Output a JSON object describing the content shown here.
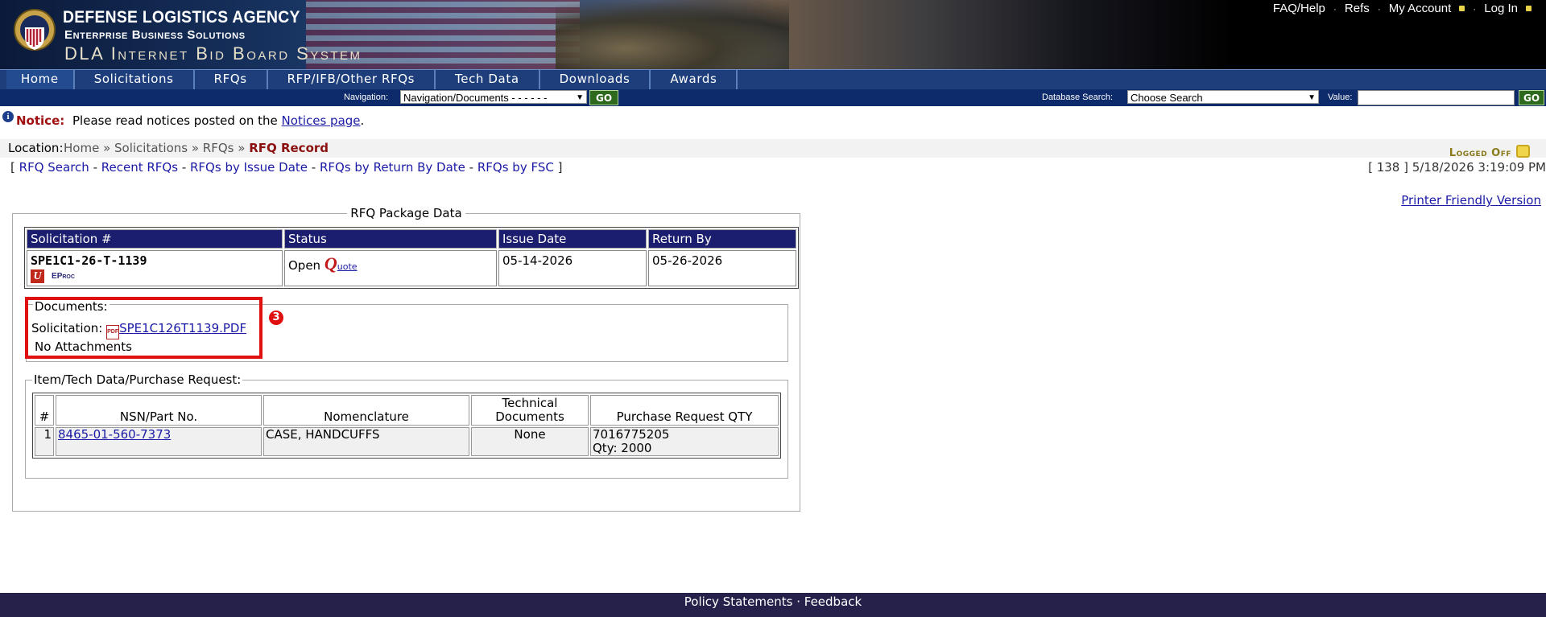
{
  "header": {
    "agency": "DEFENSE LOGISTICS AGENCY",
    "subagency": "Enterprise Business Solutions",
    "system_title": "DLA Internet Bid Board System",
    "toplinks": {
      "faq": "FAQ/Help",
      "refs": "Refs",
      "my_account": "My Account",
      "login": "Log In"
    }
  },
  "menu": [
    "Home",
    "Solicitations",
    "RFQs",
    "RFP/IFB/Other RFQs",
    "Tech Data",
    "Downloads",
    "Awards"
  ],
  "navbar": {
    "nav_label": "Navigation:",
    "nav_value": "Navigation/Documents - - - - - -",
    "go": "GO",
    "db_label": "Database Search:",
    "db_value": "Choose Search",
    "value_label": "Value:"
  },
  "notice": {
    "label": "Notice:",
    "text_before": "Please read notices posted on the ",
    "link": "Notices page",
    "text_after": "."
  },
  "location": {
    "label": "Location:",
    "crumbs": "Home » Solicitations » RFQs » ",
    "current": "RFQ Record",
    "logged_off": "Logged Off"
  },
  "sublinks": {
    "open": "[",
    "items": [
      "RFQ Search",
      "Recent RFQs",
      "RFQs by Issue Date",
      "RFQs by Return By Date",
      "RFQs by FSC"
    ],
    "sep": " - ",
    "close": "]"
  },
  "stamp": "[ 138 ] 5/18/2026 3:19:09 PM",
  "printer_link": "Printer Friendly Version",
  "package": {
    "title": "RFQ Package Data",
    "headers": [
      "Solicitation #",
      "Status",
      "Issue Date",
      "Return By"
    ],
    "solicitation": "SPE1C1-26-T-1139",
    "u_badge": "U",
    "eproc": "EProc",
    "status": "Open",
    "quote_q": "Q",
    "quote_link": "uote",
    "issue_date": "05-14-2026",
    "return_by": "05-26-2026",
    "documents_label": "Documents:",
    "solicitation_label": "Solicitation:",
    "pdf_icon_text": "PDF",
    "pdf_link": "SPE1C126T1139.PDF",
    "no_attachments": "No Attachments",
    "annotation": "3",
    "items_label": "Item/Tech Data/Purchase Request:",
    "item_headers": [
      "#",
      "NSN/Part No.",
      "Nomenclature",
      "Technical Documents",
      "Purchase Request QTY"
    ],
    "items": [
      {
        "num": "1",
        "nsn": "8465-01-560-7373",
        "nomenclature": "CASE, HANDCUFFS",
        "tech_docs": "None",
        "pr": "7016775205",
        "qty": "Qty: 2000"
      }
    ]
  },
  "footer": {
    "policy": "Policy Statements",
    "sep": " · ",
    "feedback": "Feedback"
  },
  "colors": {
    "menu_bg": "#1d3e7a",
    "nav_bg": "#0d2a6a",
    "table_header": "#1b1d6e",
    "highlight": "#e01010",
    "footer_bg": "#25214a"
  }
}
